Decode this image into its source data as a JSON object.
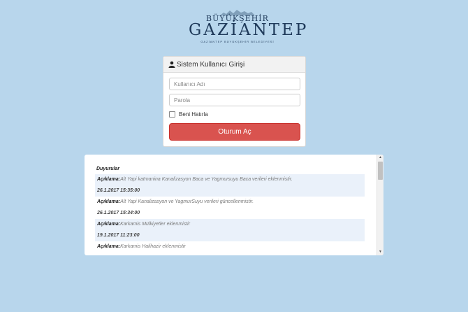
{
  "logo": {
    "top_text": "BÜYÜKŞEHİR",
    "main_text": "GAZİANTEP",
    "sub_text": "GAZİANTEP BÜYÜKŞEHİR BELEDİYESİ"
  },
  "login": {
    "title": "Sistem Kullanıcı Girişi",
    "username_placeholder": "Kullanıcı Adı",
    "password_placeholder": "Parola",
    "remember_label": "Beni Hatırla",
    "submit_label": "Oturum Aç",
    "button_color": "#d9534f"
  },
  "announcements": {
    "title": "Duyurular",
    "label": "Açıklama:",
    "items": [
      {
        "text": "Alt Yapi katmanina Kanalizasyon Baca ve Yagmursuyu Baca verileri eklenmistir.",
        "date": "26.1.2017 15:35:00"
      },
      {
        "text": "Alt Yapi Kanalizasyon ve YagmurSuyu verileri güncellenmistir.",
        "date": "26.1.2017 15:34:00"
      },
      {
        "text": "Karkamis Mülkiyetler eklenmistir",
        "date": "19.1.2017 11:23:00"
      },
      {
        "text": "Karkamis Halihazir eklenmistir"
      }
    ]
  },
  "colors": {
    "background": "#b8d6ec",
    "row_shade": "#eaf1fa"
  }
}
